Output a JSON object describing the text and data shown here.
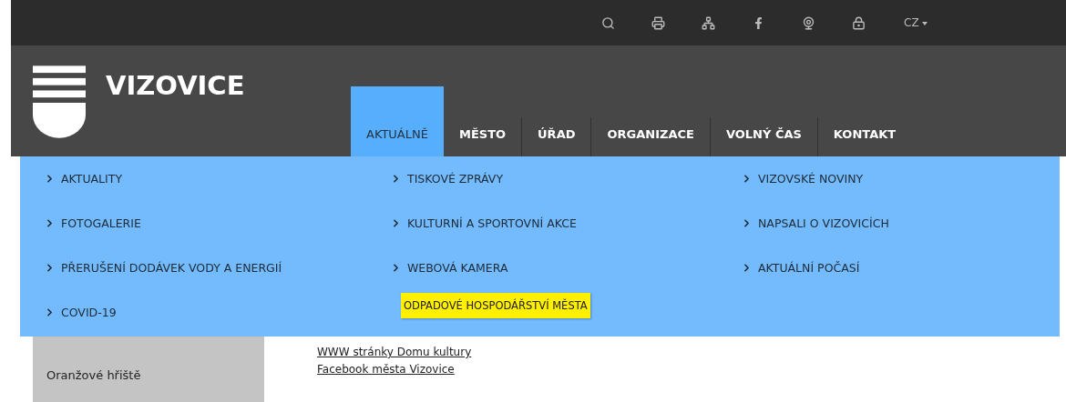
{
  "top_bar": {
    "language": "CZ"
  },
  "header": {
    "site_name": "VIZOVICE"
  },
  "nav": [
    {
      "label": "AKTUÁLNĚ",
      "selected": true
    },
    {
      "label": "MĚSTO",
      "selected": false
    },
    {
      "label": "ÚŘAD",
      "selected": false
    },
    {
      "label": "ORGANIZACE",
      "selected": false
    },
    {
      "label": "VOLNÝ ČAS",
      "selected": false
    },
    {
      "label": "KONTAKT",
      "selected": false
    }
  ],
  "sidebar": {
    "items": [
      "Oranžové hřiště"
    ]
  },
  "content": {
    "links": [
      "WWW stránky Domu kultury",
      "Facebook města Vizovice"
    ]
  },
  "mega_menu": {
    "columns": [
      [
        "AKTUALITY",
        "FOTOGALERIE",
        "PŘERUŠENÍ DODÁVEK VODY A ENERGIÍ",
        "COVID-19"
      ],
      [
        "TISKOVÉ ZPRÁVY",
        "KULTURNÍ A SPORTOVNÍ AKCE",
        "WEBOVÁ KAMERA"
      ],
      [
        "VIZOVSKÉ NOVINY",
        "NAPSALI O VIZOVICÍCH",
        "AKTUÁLNÍ POČASÍ"
      ]
    ],
    "tooltip": "ODPADOVÉ HOSPODÁŘSTVÍ MĚSTA"
  }
}
